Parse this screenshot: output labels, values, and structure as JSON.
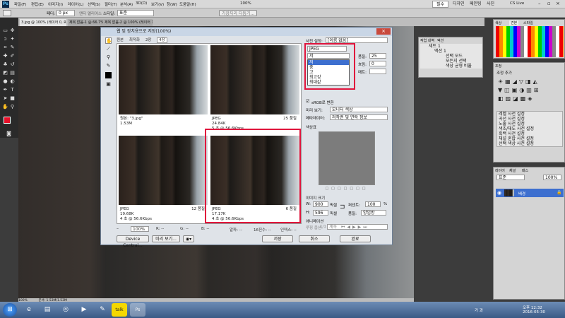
{
  "app": {
    "logo": "Ps",
    "menus": [
      "파일(F)",
      "편집(E)",
      "이미지(I)",
      "레이어(L)",
      "선택(S)",
      "필터(T)",
      "분석(A)",
      "3D(D)",
      "보기(V)",
      "창(W)",
      "도움말(H)"
    ],
    "zoom": "100%",
    "workspace_modes": [
      "필수",
      "디자인",
      "페인팅",
      "사진"
    ],
    "cslive": "CS Live"
  },
  "options": {
    "feather_label": "페더:",
    "feather_value": "0 px",
    "antialias": "앤티 앨리어스",
    "style_label": "스타일:",
    "style_value": "표준",
    "refine": "가장자리 다듬기..."
  },
  "doc_tabs": [
    "3.jpg @ 100% (레이어 0, RGB/8) ×",
    "제목 없음-1 @ 66.7% (레이어 1, RGB/8) ×",
    "제목 없음-2 @ 100% (레이어 1, RGB/8) ×"
  ],
  "dialog": {
    "title": "웹 및 장치용으로 저장(100%)",
    "view_tabs": [
      "원본",
      "최적화",
      "2장",
      "4장"
    ],
    "previews": [
      {
        "line1": "원본: \"3.jpg\"",
        "line2": "1.53M",
        "line3": "",
        "quality": ""
      },
      {
        "line1": "JPEG",
        "line2": "24.84K",
        "line3": "5 초 @ 56.6Kbps",
        "quality": "25 품질"
      },
      {
        "line1": "JPEG",
        "line2": "19.68K",
        "line3": "4 초 @ 56.6Kbps",
        "quality": "12 품질"
      },
      {
        "line1": "JPEG",
        "line2": "17.17K",
        "line3": "4 초 @ 56.6Kbps",
        "quality": "6 품질"
      }
    ],
    "status": {
      "zoom": "100%",
      "r": "R: --",
      "g": "G: --",
      "b": "B: --",
      "alpha": "알파: --",
      "hex": "16진수: --",
      "index": "인덱스: --"
    },
    "buttons": {
      "device_central": "Device Central...",
      "preview": "미리 보기...",
      "save": "저장",
      "cancel": "취소",
      "done": "완료"
    },
    "settings": {
      "preset_label": "사전 설정:",
      "preset_value": "[이름 없음]",
      "format_value": "JPEG",
      "quality_dd_value": "저",
      "quality_options": [
        "저",
        "중",
        "고",
        "최고강",
        "최대값"
      ],
      "quality_label": "품질:",
      "quality_value": "25",
      "blur_label": "흐림:",
      "blur_value": "0",
      "matte_label": "매트:",
      "srgb": "sRGB로 변환",
      "preview_label": "미리 보기:",
      "preview_value": "모니터 색상",
      "metadata_label": "메타데이터:",
      "metadata_value": "저작권 및 연락 정보",
      "color_table": "색상표",
      "image_size": "이미지 크기",
      "w_label": "W:",
      "w_value": "900",
      "h_label": "H:",
      "h_value": "596",
      "px": "픽셀",
      "percent_label": "퍼센트:",
      "percent_value": "100",
      "percent_unit": "%",
      "quality2_label": "품질:",
      "quality2_value": "양입방",
      "animation": "애니메이션",
      "loop_label": "루핑 옵션:",
      "loop_value": "계속",
      "frame": "1/1"
    }
  },
  "layers_mini": {
    "tabs": [
      "작업 내역",
      "액션"
    ],
    "items": [
      "세트 1",
      "액션 1",
      "선택 모드",
      "모든지 선택",
      "색상 균형 비율"
    ]
  },
  "swatch_tabs": [
    "색상",
    "견본",
    "스타일"
  ],
  "adjust": {
    "title": "조정",
    "add": "조정 추가",
    "presets": [
      "레벨 사전 설정",
      "곡선 사전 설정",
      "노출 사전 설정",
      "색조/채도 사전 설정",
      "흑백 사전 설정",
      "채널 혼합 사전 설정",
      "선택 색상 사전 설정"
    ]
  },
  "layers": {
    "tabs": [
      "레이어",
      "채널",
      "패스"
    ],
    "mode": "표준",
    "opacity": "100%",
    "layer_name": "배경"
  },
  "statusbar": {
    "zoom": "100%",
    "doc": "문서: 1.53M/1.53M"
  },
  "clock": {
    "time": "오후 12:32",
    "date": "2016-05-30"
  },
  "colors": {
    "accent": "#e0143c",
    "fg": "#e8102a"
  }
}
